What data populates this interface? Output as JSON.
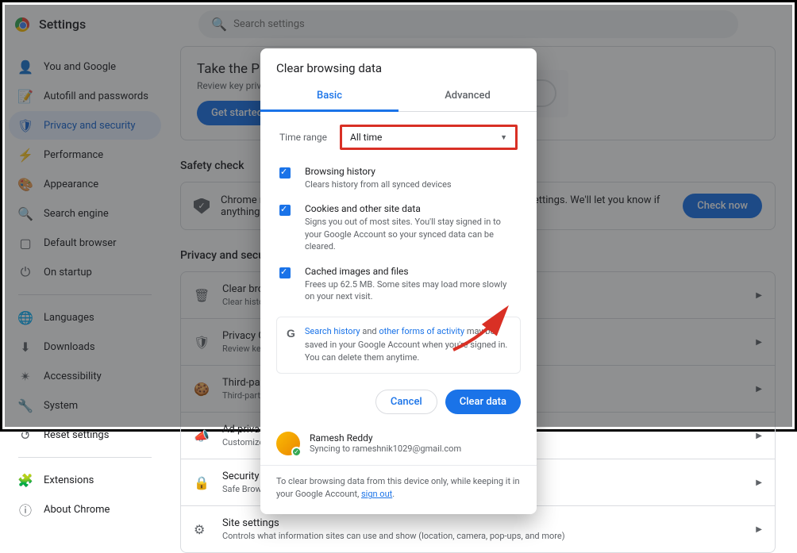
{
  "header": {
    "title": "Settings",
    "search_placeholder": "Search settings"
  },
  "sidebar": {
    "items": [
      {
        "label": "You and Google",
        "icon": "👤"
      },
      {
        "label": "Autofill and passwords",
        "icon": "📝"
      },
      {
        "label": "Privacy and security",
        "icon": "🛡",
        "active": true
      },
      {
        "label": "Performance",
        "icon": "⚡"
      },
      {
        "label": "Appearance",
        "icon": "🎨"
      },
      {
        "label": "Search engine",
        "icon": "🔍"
      },
      {
        "label": "Default browser",
        "icon": "▢"
      },
      {
        "label": "On startup",
        "icon": "⏻"
      }
    ],
    "items2": [
      {
        "label": "Languages",
        "icon": "🌐"
      },
      {
        "label": "Downloads",
        "icon": "⬇"
      },
      {
        "label": "Accessibility",
        "icon": "✴"
      },
      {
        "label": "System",
        "icon": "🔧"
      },
      {
        "label": "Reset settings",
        "icon": "↺"
      }
    ],
    "items3": [
      {
        "label": "Extensions",
        "icon": "🧩"
      },
      {
        "label": "About Chrome",
        "icon": "ⓘ"
      }
    ]
  },
  "content": {
    "guide_title": "Take the Privacy Guide",
    "guide_desc": "Review key privacy and security controls in Chrome",
    "guide_btn": "Get started",
    "safety_title": "Safety check",
    "safety_desc": "Chrome regularly checks to make sure your browser has the safest settings. We'll let you know if anything needs your review.",
    "safety_btn": "Check now",
    "privacy_title": "Privacy and security",
    "rows": [
      {
        "icon": "🗑",
        "t": "Clear browsing data",
        "d": "Clear history, cookies, cache, and more"
      },
      {
        "icon": "🛡",
        "t": "Privacy Guide",
        "d": "Review key privacy and security controls"
      },
      {
        "icon": "🍪",
        "t": "Third-party cookies",
        "d": "Third-party cookies are blocked in Incognito mode"
      },
      {
        "icon": "📣",
        "t": "Ad privacy",
        "d": "Customize the info used by sites to show you ads"
      },
      {
        "icon": "🔒",
        "t": "Security",
        "d": "Safe Browsing (protection from dangerous sites) and other security settings"
      },
      {
        "icon": "⚙",
        "t": "Site settings",
        "d": "Controls what information sites can use and show (location, camera, pop-ups, and more)"
      }
    ]
  },
  "modal": {
    "title": "Clear browsing data",
    "tab_basic": "Basic",
    "tab_advanced": "Advanced",
    "time_label": "Time range",
    "time_value": "All time",
    "checks": [
      {
        "t": "Browsing history",
        "d": "Clears history from all synced devices"
      },
      {
        "t": "Cookies and other site data",
        "d": "Signs you out of most sites. You'll stay signed in to your Google Account so your synced data can be cleared."
      },
      {
        "t": "Cached images and files",
        "d": "Frees up 62.5 MB. Some sites may load more slowly on your next visit."
      }
    ],
    "info_search": "Search history",
    "info_and": " and ",
    "info_other": "other forms of activity",
    "info_rest": " may be saved in your Google Account when you're signed in. You can delete them anytime.",
    "cancel": "Cancel",
    "clear": "Clear data",
    "user_name": "Ramesh Reddy",
    "user_sync": "Syncing to rameshnik1029@gmail.com",
    "footer_pre": "To clear browsing data from this device only, while keeping it in your Google Account, ",
    "footer_link": "sign out",
    "footer_post": "."
  }
}
